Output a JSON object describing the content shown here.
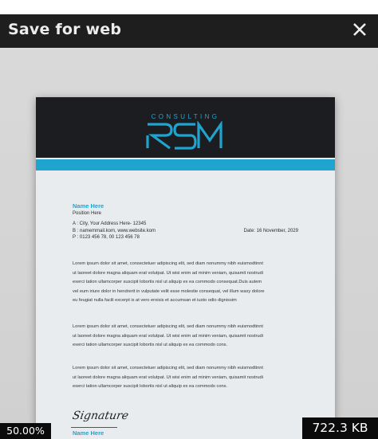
{
  "dialog": {
    "title": "Save for web",
    "close_icon": "close-icon"
  },
  "preview": {
    "logo": {
      "tagline": "CONSULTING",
      "mark": "RSM",
      "accent_color": "#1fa4cf",
      "header_color": "#1b1d21"
    },
    "sender": {
      "name": "Name Here",
      "position": "Position Here",
      "address": "A : City, Your Address Here- 12345",
      "email_web": "B : namemmail.kom, www.website.kom",
      "phone": "P : 0123 456 78,  00 123 456 78"
    },
    "date": "Date: 16 November, 2029",
    "paragraphs": [
      {
        "lines": [
          "Lorem ipsum dolor sit amet, consectetuer adipiscing elit, sed diam nonummy nibh euismodtinnt",
          "ut laoreet dolore magna aliquam erat volutpat. Ut wisi enim ad minim veniam, quisamit nostrudi",
          "exerci tation ullamcorper suscipit lobortis nisl ut aliquip ex ea commodo consequat.Duis autem",
          "vel eum iriure dolor in hendrerit in vulputate velit esse molestie consequat, vel illum waxy dolore",
          "eu feugiat nulla facili excerpt is at vero eroisis et accumsan et iusto odio dignissim"
        ]
      },
      {
        "lines": [
          "Lorem ipsum dolor sit amet, consectetuer adipiscing elit, sed diam nonummy nibh euismodtinnt",
          "ut laoreet dolore magna aliquam erat volutpat. Ut wisi enim ad minim veniam, quisamit nostrudi",
          "exerci tation ullamcorper suscipit lobortis nisl ut aliquip ex ea commodo cons."
        ]
      },
      {
        "lines": [
          "Lorem ipsum dolor sit amet, consectetuer adipiscing elit, sed diam nonummy nibh euismodtinnt",
          "ut laoreet dolore magna aliquam erat volutpat. Ut wisi enim ad minim veniam, quisamit nostrudi",
          "exerci tation ullamcorper suscipit lobortis nisl ut aliquip ex ea commodo cons."
        ]
      }
    ],
    "signature": "Signature",
    "signer_name": "Name Here"
  },
  "status": {
    "zoom": "50.00%",
    "file_size": "722.3 KB"
  }
}
